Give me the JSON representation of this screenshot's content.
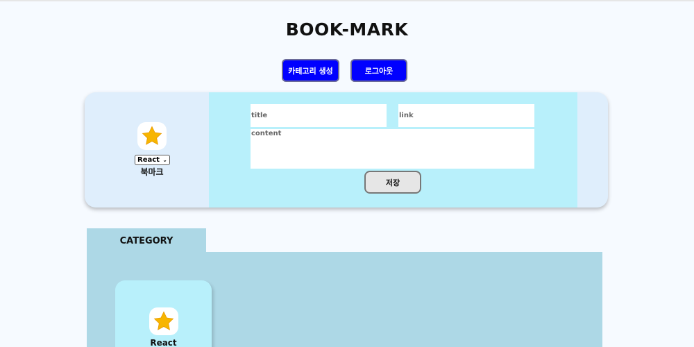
{
  "header": {
    "title": "BOOK-MARK",
    "create_category_label": "카테고리 생성",
    "logout_label": "로그아웃"
  },
  "form": {
    "icon": "star-icon",
    "selected_category": "React",
    "bookmark_label": "북마크",
    "title_placeholder": "title",
    "link_placeholder": "link",
    "content_placeholder": "content",
    "title_value": "",
    "link_value": "",
    "content_value": "",
    "save_label": "저장"
  },
  "category_section": {
    "tab_label": "CATEGORY",
    "items": [
      {
        "name": "React",
        "icon": "star-icon"
      }
    ]
  },
  "colors": {
    "accent_button": "#0000ff",
    "form_bg": "#b8f0fb",
    "card_bg": "#dfeefc",
    "panel_bg": "#add8e6",
    "star": "#f7b500"
  }
}
